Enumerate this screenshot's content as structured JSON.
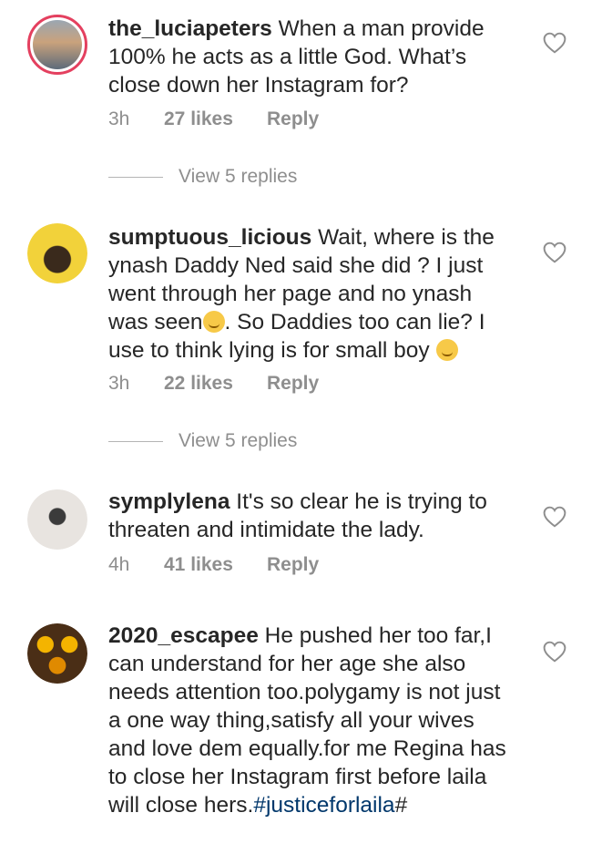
{
  "comments": [
    {
      "username": "the_luciapeters",
      "text": "When a man provide 100% he acts as a little God. What’s close down her Instagram for?",
      "time": "3h",
      "likes": "27 likes",
      "reply": "Reply",
      "view_replies": "View 5 replies"
    },
    {
      "username": "sumptuous_licious",
      "text_a": "Wait, where is the ynash Daddy Ned said she did ? I just went through her page and no ynash was seen",
      "text_b": ". So Daddies too can lie? I use to think lying is for small boy ",
      "time": "3h",
      "likes": "22 likes",
      "reply": "Reply",
      "view_replies": "View 5 replies"
    },
    {
      "username": "symplylena",
      "text": "It's so clear he is trying to threaten and intimidate the lady.",
      "time": "4h",
      "likes": "41 likes",
      "reply": "Reply"
    },
    {
      "username": "2020_escapee",
      "text": "He pushed her too far,I can understand for her age she also needs attention too.polygamy is not just a one way thing,satisfy all your wives and love dem equally.for me Regina has to close her Instagram first before laila will close hers.",
      "hashtag": "#justiceforlaila",
      "tail": "#"
    }
  ],
  "icons": {
    "like": "heart-outline-icon",
    "emoji_smirk": "smirking-face-emoji",
    "emoji_woozy": "woozy-face-emoji"
  },
  "colors": {
    "text": "#262626",
    "meta": "#8e8e8e",
    "hashtag": "#00376b",
    "story_ring": "#e4405f"
  }
}
